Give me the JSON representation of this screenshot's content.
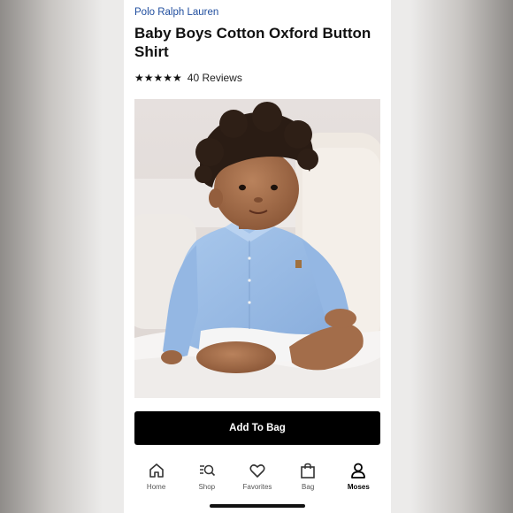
{
  "product": {
    "brand": "Polo Ralph Lauren",
    "title": "Baby Boys Cotton Oxford Button Shirt",
    "stars": "★★★★★",
    "rating_value": 5,
    "reviews": "40 Reviews",
    "image_alt": "Baby wearing a light blue oxford button-down shirt and white shorts"
  },
  "actions": {
    "add_to_bag": "Add To Bag"
  },
  "nav": {
    "items": [
      {
        "label": "Home",
        "icon": "home-icon"
      },
      {
        "label": "Shop",
        "icon": "search-list-icon"
      },
      {
        "label": "Favorites",
        "icon": "heart-icon"
      },
      {
        "label": "Bag",
        "icon": "bag-icon"
      },
      {
        "label": "Moses",
        "icon": "person-icon",
        "active": true
      }
    ]
  },
  "colors": {
    "brand": "#1f4d9e",
    "button": "#000000",
    "shirt": "#9dbfe6"
  }
}
